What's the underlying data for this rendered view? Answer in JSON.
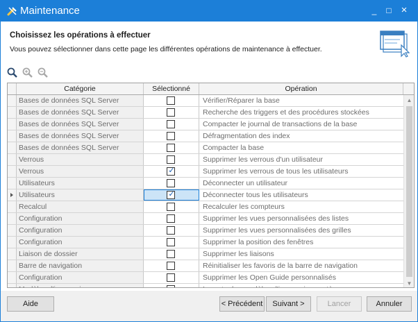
{
  "window": {
    "title": "Maintenance",
    "minimize_label": "_",
    "maximize_label": "□",
    "close_label": "×"
  },
  "header": {
    "title": "Choisissez les opérations à effectuer",
    "subtitle": "Vous pouvez sélectionner dans cette page les différentes opérations de maintenance à effectuer."
  },
  "toolbar": {
    "icons": [
      "zoom-icon",
      "zoom-in-icon",
      "zoom-out-icon"
    ]
  },
  "grid": {
    "columns": [
      "Catégorie",
      "Sélectionné",
      "Opération"
    ],
    "rows": [
      {
        "category": "Bases de données SQL Server",
        "selected": false,
        "operation": "Vérifier/Réparer la base"
      },
      {
        "category": "Bases de données SQL Server",
        "selected": false,
        "operation": "Recherche des triggers et des procédures stockées"
      },
      {
        "category": "Bases de données SQL Server",
        "selected": false,
        "operation": "Compacter le journal de transactions de la base"
      },
      {
        "category": "Bases de données SQL Server",
        "selected": false,
        "operation": "Défragmentation des index"
      },
      {
        "category": "Bases de données SQL Server",
        "selected": false,
        "operation": "Compacter la base"
      },
      {
        "category": "Verrous",
        "selected": false,
        "operation": "Supprimer les verrous d'un utilisateur"
      },
      {
        "category": "Verrous",
        "selected": true,
        "operation": "Supprimer les verrous de tous les utilisateurs"
      },
      {
        "category": "Utilisateurs",
        "selected": false,
        "operation": "Déconnecter un utilisateur"
      },
      {
        "category": "Utilisateurs",
        "selected": true,
        "operation": "Déconnecter tous les utilisateurs",
        "current": true
      },
      {
        "category": "Recalcul",
        "selected": false,
        "operation": "Recalculer les compteurs"
      },
      {
        "category": "Configuration",
        "selected": false,
        "operation": "Supprimer les vues personnalisées des listes"
      },
      {
        "category": "Configuration",
        "selected": false,
        "operation": "Supprimer les vues personnalisées des grilles"
      },
      {
        "category": "Configuration",
        "selected": false,
        "operation": "Supprimer la position des fenêtres"
      },
      {
        "category": "Liaison de dossier",
        "selected": false,
        "operation": "Supprimer les liaisons"
      },
      {
        "category": "Barre de navigation",
        "selected": false,
        "operation": "Réinitialiser les favoris de la barre de navigation"
      },
      {
        "category": "Configuration",
        "selected": false,
        "operation": "Supprimer les Open Guide personnalisés"
      },
      {
        "category": "Modèles d'impression",
        "selected": false,
        "operation": "Importer les modèles d'impression système"
      }
    ]
  },
  "footer": {
    "help": "Aide",
    "previous": "< Précédent",
    "next": "Suivant >",
    "launch": "Lancer",
    "cancel": "Annuler"
  },
  "colors": {
    "titlebar": "#1c7fd8",
    "check": "#1a5fb4",
    "selection": "#cce4f7"
  }
}
